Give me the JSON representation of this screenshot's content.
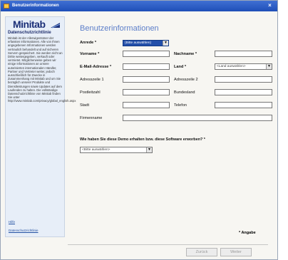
{
  "window": {
    "title": "Benutzerinformationen",
    "close_glyph": "×"
  },
  "sidebar": {
    "logo_text": "Minitab",
    "heading": "Datenschutzrichtlinie",
    "body": "Minitab ist der Allerwigentümer der erfassten Informationen. Alle von Ihnen angegebenen Informationen werden vertraulich behandelt und auf sicheren Servern gespeichert. Sie werden nicht an Dritte weitergegeben, verkauft oder vermietet. Möglicherweise geben wir einige Informationen an unsere autorisierten internationalen Händler, Partner und Vertreter weiter, jedoch ausschließlich für Zwecke in Zusammenhang mit Minitab und um Sie bezüglich unserer Produkte und Dienstleistungen sowie Updates auf dem Laufenden zu halten. Die vollständige Datenschutzrichtlinie von Minitab finden Sie unter http://www.minitab.com/privacy/global_english.aspx",
    "link_info": "Hilfe",
    "link_policy": "Datenschutzrichtlinie"
  },
  "form": {
    "title": "Benutzerinformationen",
    "anrede_label": "Anrede *",
    "anrede_value": "(Bitte auswählen)",
    "vorname_label": "Vorname *",
    "nachname_label": "Nachname *",
    "email_label": "E-Mail-Adresse *",
    "land_label": "Land *",
    "land_value": "<Land auswählen>",
    "adresse1_label": "Adresszeile 1",
    "adresse2_label": "Adresszeile 2",
    "postleitzahl_label": "Postleitzahl",
    "bundesland_label": "Bundesland",
    "stadt_label": "Stadt",
    "telefon_label": "Telefon",
    "firmenname_label": "Firmenname",
    "question": "Wie haben Sie diese Demo erhalten bzw. diese Software erworben? *",
    "question_value": "<Bitte auswählen>",
    "required_note": "* Angabe"
  },
  "buttons": {
    "back": "Zurück",
    "next": "Weiter"
  },
  "colors": {
    "titlebar": "#1f4fb8",
    "logo": "#1b2f78",
    "heading": "#5c7ec9"
  }
}
